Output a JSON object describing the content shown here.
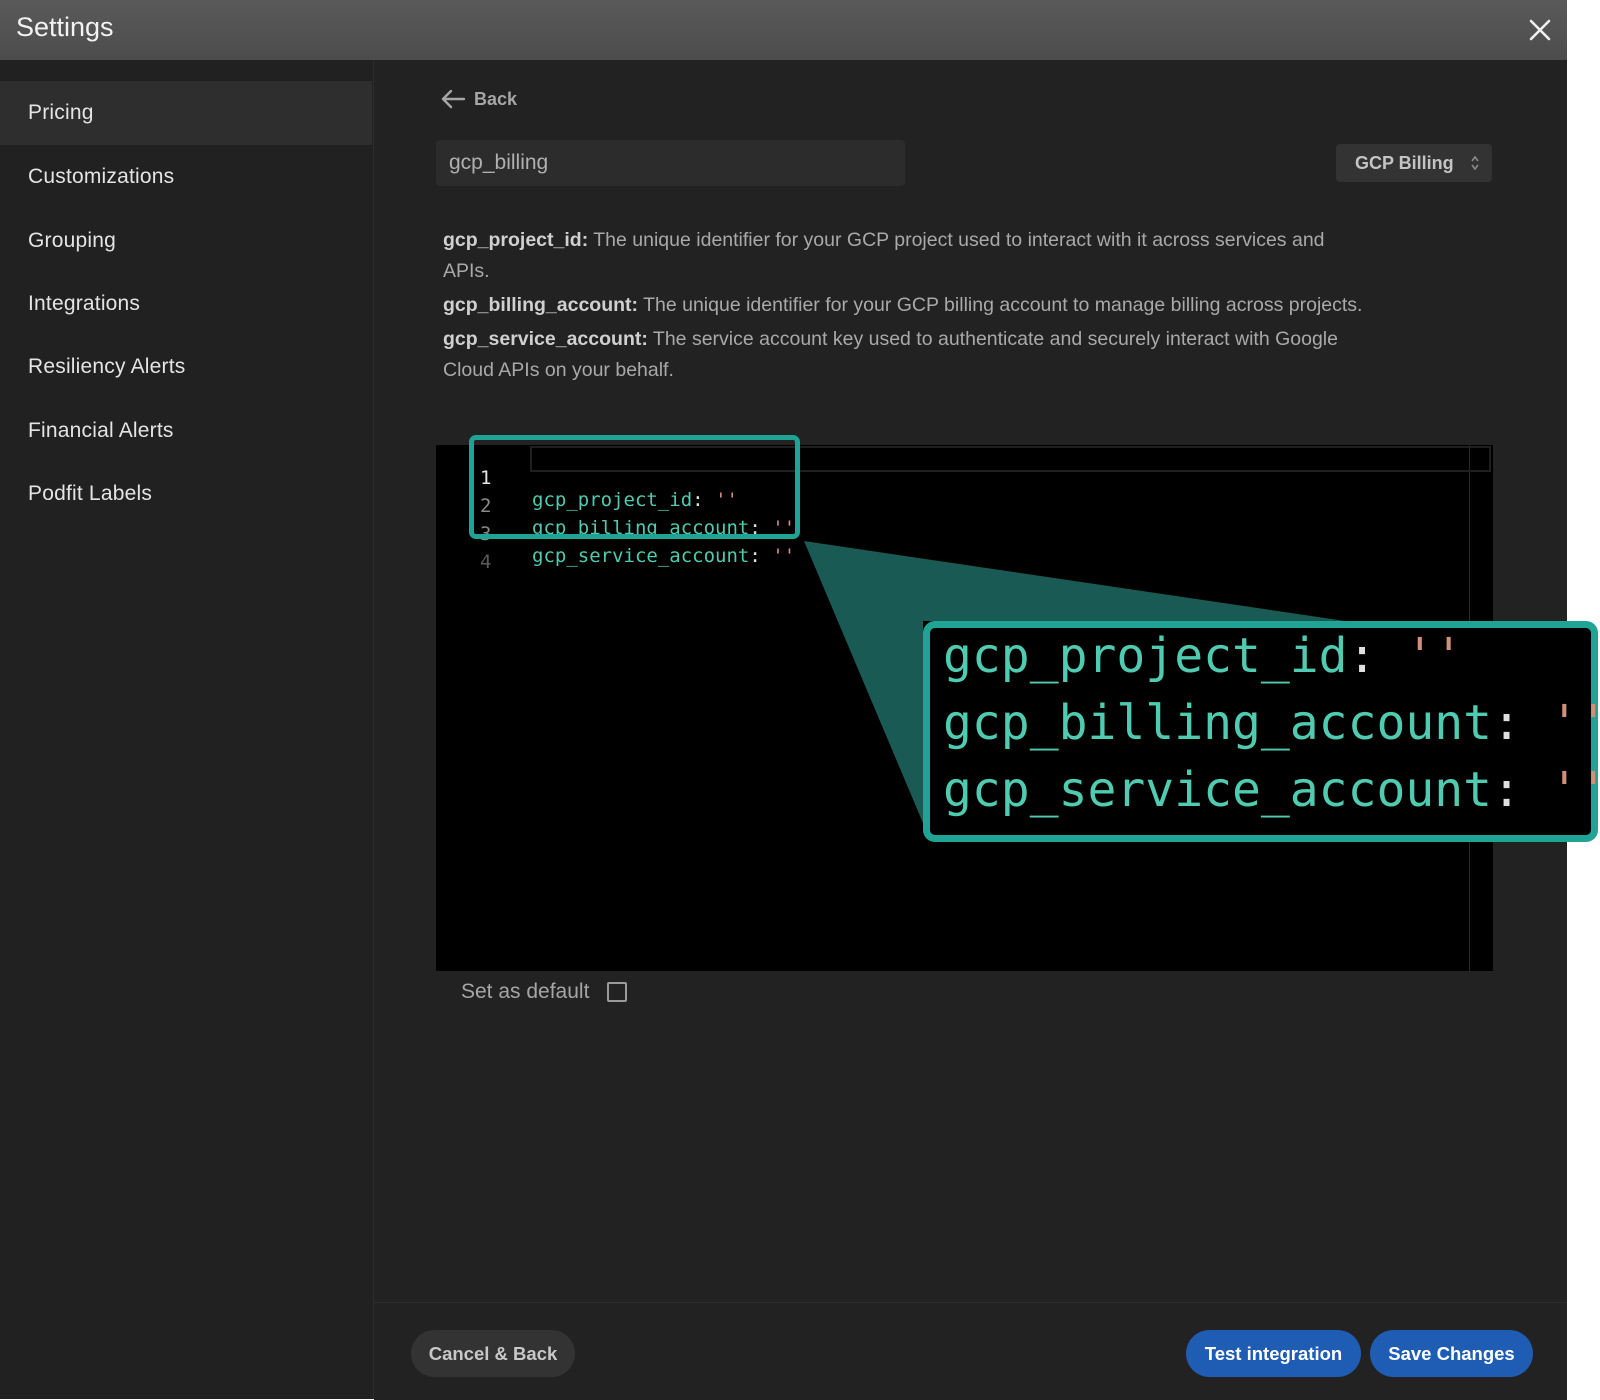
{
  "window": {
    "title": "Settings"
  },
  "sidebar": {
    "items": [
      {
        "label": "Pricing",
        "active": true
      },
      {
        "label": "Customizations"
      },
      {
        "label": "Grouping"
      },
      {
        "label": "Integrations"
      },
      {
        "label": "Resiliency Alerts"
      },
      {
        "label": "Financial Alerts"
      },
      {
        "label": "Podfit Labels"
      }
    ]
  },
  "main": {
    "back_label": "Back",
    "name_value": "gcp_billing",
    "type_select": {
      "selected": "GCP Billing"
    },
    "descriptions": [
      {
        "key": "gcp_project_id:",
        "text": " The unique identifier for your GCP project used to interact with it across services and APIs."
      },
      {
        "key": "gcp_billing_account:",
        "text": " The unique identifier for your GCP billing account to manage billing across projects."
      },
      {
        "key": "gcp_service_account:",
        "text": " The service account key used to authenticate and securely interact with Google Cloud APIs on your behalf."
      }
    ],
    "editor": {
      "lines": [
        {
          "num": "1",
          "key": "gcp_project_id",
          "colon": ":",
          "value": "''"
        },
        {
          "num": "2",
          "key": "gcp_billing_account",
          "colon": ":",
          "value": "''"
        },
        {
          "num": "3",
          "key": "gcp_service_account",
          "colon": ":",
          "value": "''"
        },
        {
          "num": "4",
          "key": "",
          "colon": "",
          "value": ""
        }
      ]
    },
    "default_label": "Set as default",
    "default_checked": false
  },
  "footer": {
    "cancel_label": "Cancel & Back",
    "test_label": "Test integration",
    "save_label": "Save Changes"
  },
  "colors": {
    "accent_teal": "#1fa395",
    "code_key": "#4ecbb0",
    "code_string": "#d0907a",
    "primary_button": "#1f5db5"
  }
}
